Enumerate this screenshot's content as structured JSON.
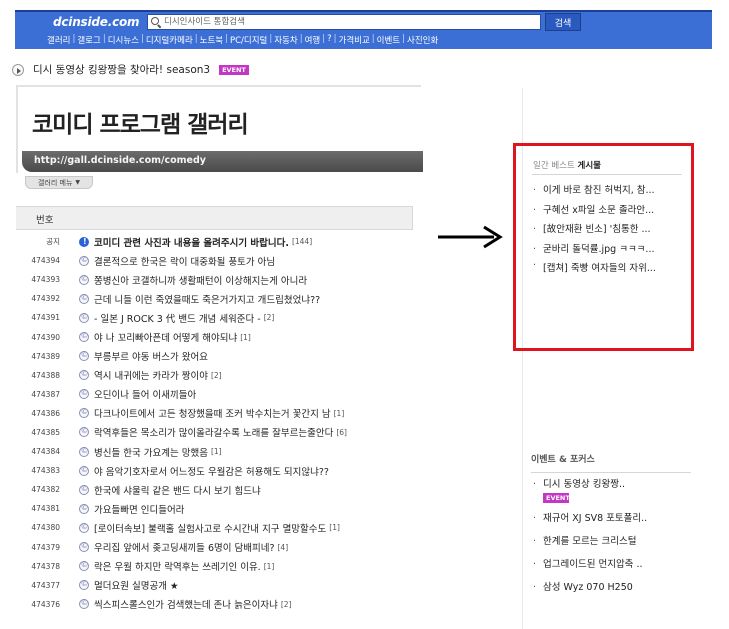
{
  "topbar": {
    "logo": "dcinside.com",
    "search_placeholder": "디시인사이드 통합검색",
    "search_button": "검색",
    "nav": [
      "갤러리",
      "갤로그",
      "디시뉴스",
      "디지털카메라",
      "노트북",
      "PC/디지털",
      "자동차",
      "여행",
      "?",
      "가격비교",
      "이벤트",
      "사진인화"
    ]
  },
  "notice": {
    "text": "디시 동영상 킹왕짱을 찾아라! season3",
    "badge": "EVENT"
  },
  "gallery": {
    "title": "코미디 프로그램 갤러리",
    "url": "http://gall.dcinside.com/comedy",
    "menu_label": "갤러리 메뉴",
    "list_header": "번호"
  },
  "posts": [
    {
      "no": "공지",
      "title": "코미디 관련 사진과 내용을 올려주시기 바랍니다.",
      "count": "[144]",
      "bold": true
    },
    {
      "no": "474394",
      "title": "결론적으로 한국은 락이 대중화될 풍토가 아님",
      "count": ""
    },
    {
      "no": "474393",
      "title": "쫑병신아 코갤하니까 생활패턴이 이상해지는게 아니라",
      "count": ""
    },
    {
      "no": "474392",
      "title": "근데 니들 이런 죽였을때도 죽은거가지고 개드립쳤었냐??",
      "count": ""
    },
    {
      "no": "474391",
      "title": "- 일본 J ROCK 3 代 밴드 개념 세워준다 -",
      "count": "[2]"
    },
    {
      "no": "474390",
      "title": "야 나 꼬리빠아픈데 어떻게 해야되냐",
      "count": "[1]"
    },
    {
      "no": "474389",
      "title": "부릉부르 야동 버스가 왔어요",
      "count": ""
    },
    {
      "no": "474388",
      "title": "역시 내귀에는 카라가 짱이야",
      "count": "[2]"
    },
    {
      "no": "474387",
      "title": "오딘이나 들어 이새끼들아",
      "count": ""
    },
    {
      "no": "474386",
      "title": "다크나이트에서 고든 청장했을때 조커 박수치는거 꽃간지 남",
      "count": "[1]"
    },
    {
      "no": "474385",
      "title": "락역후들은 목소리가 많이올라갈수록 노래를 잘부르는줄안다",
      "count": "[6]"
    },
    {
      "no": "474384",
      "title": "병신들 한국 가요계는 망했음",
      "count": "[1]"
    },
    {
      "no": "474383",
      "title": "야 음악기호자로서 어느정도 우월감은 허용해도 되지않냐??",
      "count": ""
    },
    {
      "no": "474382",
      "title": "한국에 샤울릭 같은 밴드 다시 보기 힘드냐",
      "count": ""
    },
    {
      "no": "474381",
      "title": "가요들빠면 인디들어라",
      "count": ""
    },
    {
      "no": "474380",
      "title": "[로이터속보] 불랙홀 실험사고로 수시간내 지구 멸망할수도",
      "count": "[1]"
    },
    {
      "no": "474379",
      "title": "우리집 앞에서 좆고딩새끼들 6명이 담배피네?",
      "count": "[4]"
    },
    {
      "no": "474378",
      "title": "락은 우월 하지만 락역후는 쓰레기인 이유.",
      "count": "[1]"
    },
    {
      "no": "474377",
      "title": "멀더요원 실명공개 ★",
      "count": ""
    },
    {
      "no": "474376",
      "title": "씩스피스롤스인가 검색했는데 존나 늙은이자냐",
      "count": "[2]"
    }
  ],
  "best": {
    "title_prefix": "일간 베스트",
    "title_main": "게시물",
    "items": [
      "이게 바로 참진 허벅지, 참...",
      "구혜선 x파일 소문 졸라안...",
      "[故안재환 빈소] '침통한 ...",
      "굳바리 돌덕률.jpg ㅋㅋㅋ...",
      "[캡쳐] 죽빵 여자들의 자위..."
    ]
  },
  "events": {
    "title": "이벤트 & 포커스",
    "items": [
      {
        "text": "디시 동영상 킹왕짱..",
        "badge": "EVENT"
      },
      {
        "text": "재규어 XJ SV8 포토폴리.."
      },
      {
        "text": "한계를 모르는 크리스털"
      },
      {
        "text": "업그레이드된 먼지압축 .."
      },
      {
        "text": "삼성 Wyz 070 H250"
      }
    ]
  },
  "colors": {
    "topbar": "#3b6fd6",
    "highlight_border": "#e0141e",
    "event_badge": "#c437c4"
  }
}
